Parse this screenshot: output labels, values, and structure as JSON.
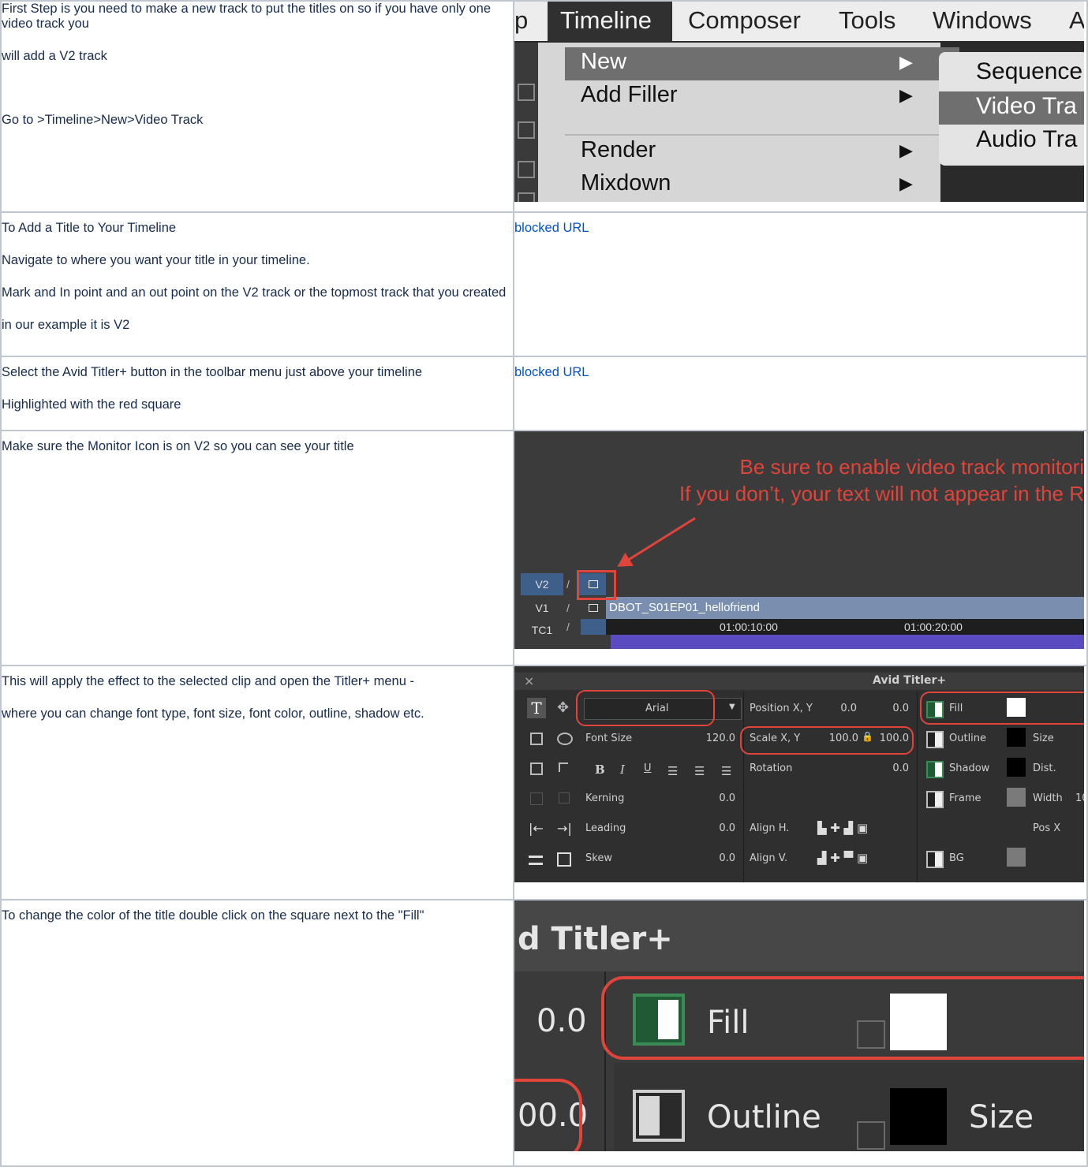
{
  "rows": [
    {
      "paragraphs": [
        "First Step is you need to make a new track to put the titles on so if you have only one video track you",
        "will add a V2 track",
        "Go to >Timeline>New>Video Track"
      ]
    },
    {
      "paragraphs": [
        "To Add a Title to Your Timeline",
        "Navigate to where you want your title in your timeline.",
        "Mark and In point and an out point on the V2 track or the topmost track that you created",
        "in our example it is V2"
      ],
      "link": "blocked URL"
    },
    {
      "paragraphs": [
        "Select the Avid Titler+ button in the toolbar menu just above your timeline",
        "Highlighted with the red square"
      ],
      "link": "blocked URL"
    },
    {
      "paragraphs": [
        "Make sure the Monitor Icon is on V2 so you can see your title"
      ]
    },
    {
      "paragraphs": [
        "This will apply the effect to the selected clip and open the Titler+ menu -",
        "where you can change font type, font size, font color, outline, shadow etc."
      ]
    },
    {
      "paragraphs": [
        "To change the color of the title double click on the square next to the \"Fill\""
      ]
    }
  ],
  "menu_shot": {
    "menubar": [
      "p",
      "Timeline",
      "Composer",
      "Tools",
      "Windows",
      "A"
    ],
    "items": [
      "New",
      "Add Filler",
      "Render",
      "Mixdown"
    ],
    "arrow": "▶",
    "submenu": [
      "Sequence",
      "Video Tra",
      "Audio Tra"
    ]
  },
  "timeline_shot": {
    "message_line1": "Be sure to enable video track monitori",
    "message_line2": "If you don’t, your text will not appear in the R",
    "tracks": [
      "V2",
      "V1",
      "TC1"
    ],
    "clip_name": "DBOT_S01EP01_hellofriend",
    "timecodes": [
      "01:00:10:00",
      "01:00:20:00"
    ]
  },
  "titler_shot": {
    "title": "Avid Titler+",
    "close": "×",
    "font": "Arial",
    "labels": {
      "font_size": "Font Size",
      "kerning": "Kerning",
      "leading": "Leading",
      "skew": "Skew",
      "position": "Position X, Y",
      "scale": "Scale X, Y",
      "rotation": "Rotation",
      "align_h": "Align H.",
      "align_v": "Align V.",
      "fill": "Fill",
      "outline": "Outline",
      "shadow": "Shadow",
      "frame": "Frame",
      "bg": "BG",
      "size": "Size",
      "dist": "Dist.",
      "width": "Width",
      "posx": "Pos X",
      "width_val": "10"
    },
    "values": {
      "font_size": "120.0",
      "kerning": "0.0",
      "leading": "0.0",
      "skew": "0.0",
      "pos_x": "0.0",
      "pos_y": "0.0",
      "scale_x": "100.0",
      "scale_y": "100.0",
      "rotation": "0.0"
    },
    "format_buttons": [
      "B",
      "I",
      "U"
    ]
  },
  "zoom_shot": {
    "title": "d Titler+",
    "value_top": "0.0",
    "value_bottom": "00.0",
    "fill": "Fill",
    "outline": "Outline",
    "size": "Size"
  },
  "colors": {
    "accent_red": "#e0443a",
    "link": "#0052cc",
    "border": "#c1c7d0"
  }
}
